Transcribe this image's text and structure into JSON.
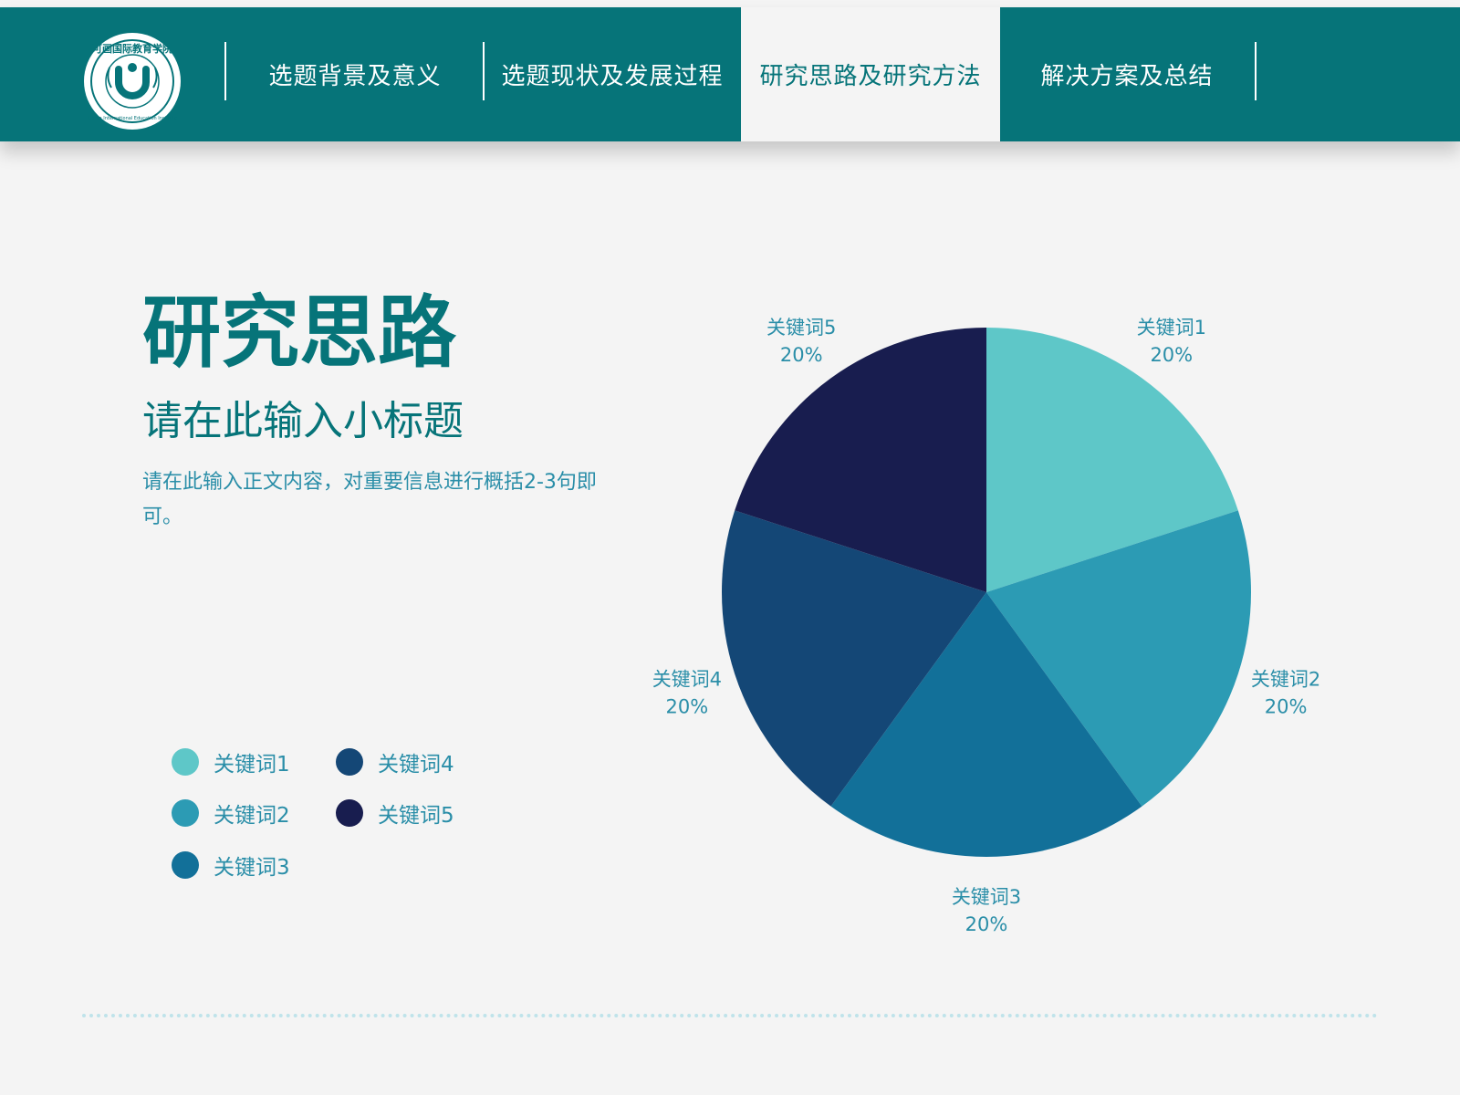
{
  "header": {
    "logo": {
      "name": "可画国际教育学院",
      "subtitle": "Canva International Education Institute",
      "mark": "U"
    },
    "tabs": [
      {
        "label": "选题背景及意义",
        "active": false
      },
      {
        "label": "选题现状及发展过程",
        "active": false
      },
      {
        "label": "研究思路及研究方法",
        "active": true
      },
      {
        "label": "解决方案及总结",
        "active": false
      }
    ]
  },
  "content": {
    "title": "研究思路",
    "subtitle": "请在此输入小标题",
    "body": "请在此输入正文内容，对重要信息进行概括2-3句即可。"
  },
  "colors": {
    "primary": "#067479",
    "text_accent": "#2a8ea8",
    "background": "#f4f4f4"
  },
  "chart_data": {
    "type": "pie",
    "title": "",
    "categories": [
      "关键词1",
      "关键词2",
      "关键词3",
      "关键词4",
      "关键词5"
    ],
    "values": [
      20,
      20,
      20,
      20,
      20
    ],
    "value_labels": [
      "20%",
      "20%",
      "20%",
      "20%",
      "20%"
    ],
    "colors": [
      "#5ec7c8",
      "#2c9bb4",
      "#127099",
      "#144776",
      "#181d4f"
    ],
    "start_angle": "12 o'clock",
    "direction": "clockwise",
    "legend": {
      "placement": "bottom-left",
      "columns": [
        [
          "关键词1",
          "关键词2",
          "关键词3"
        ],
        [
          "关键词4",
          "关键词5"
        ]
      ]
    }
  }
}
